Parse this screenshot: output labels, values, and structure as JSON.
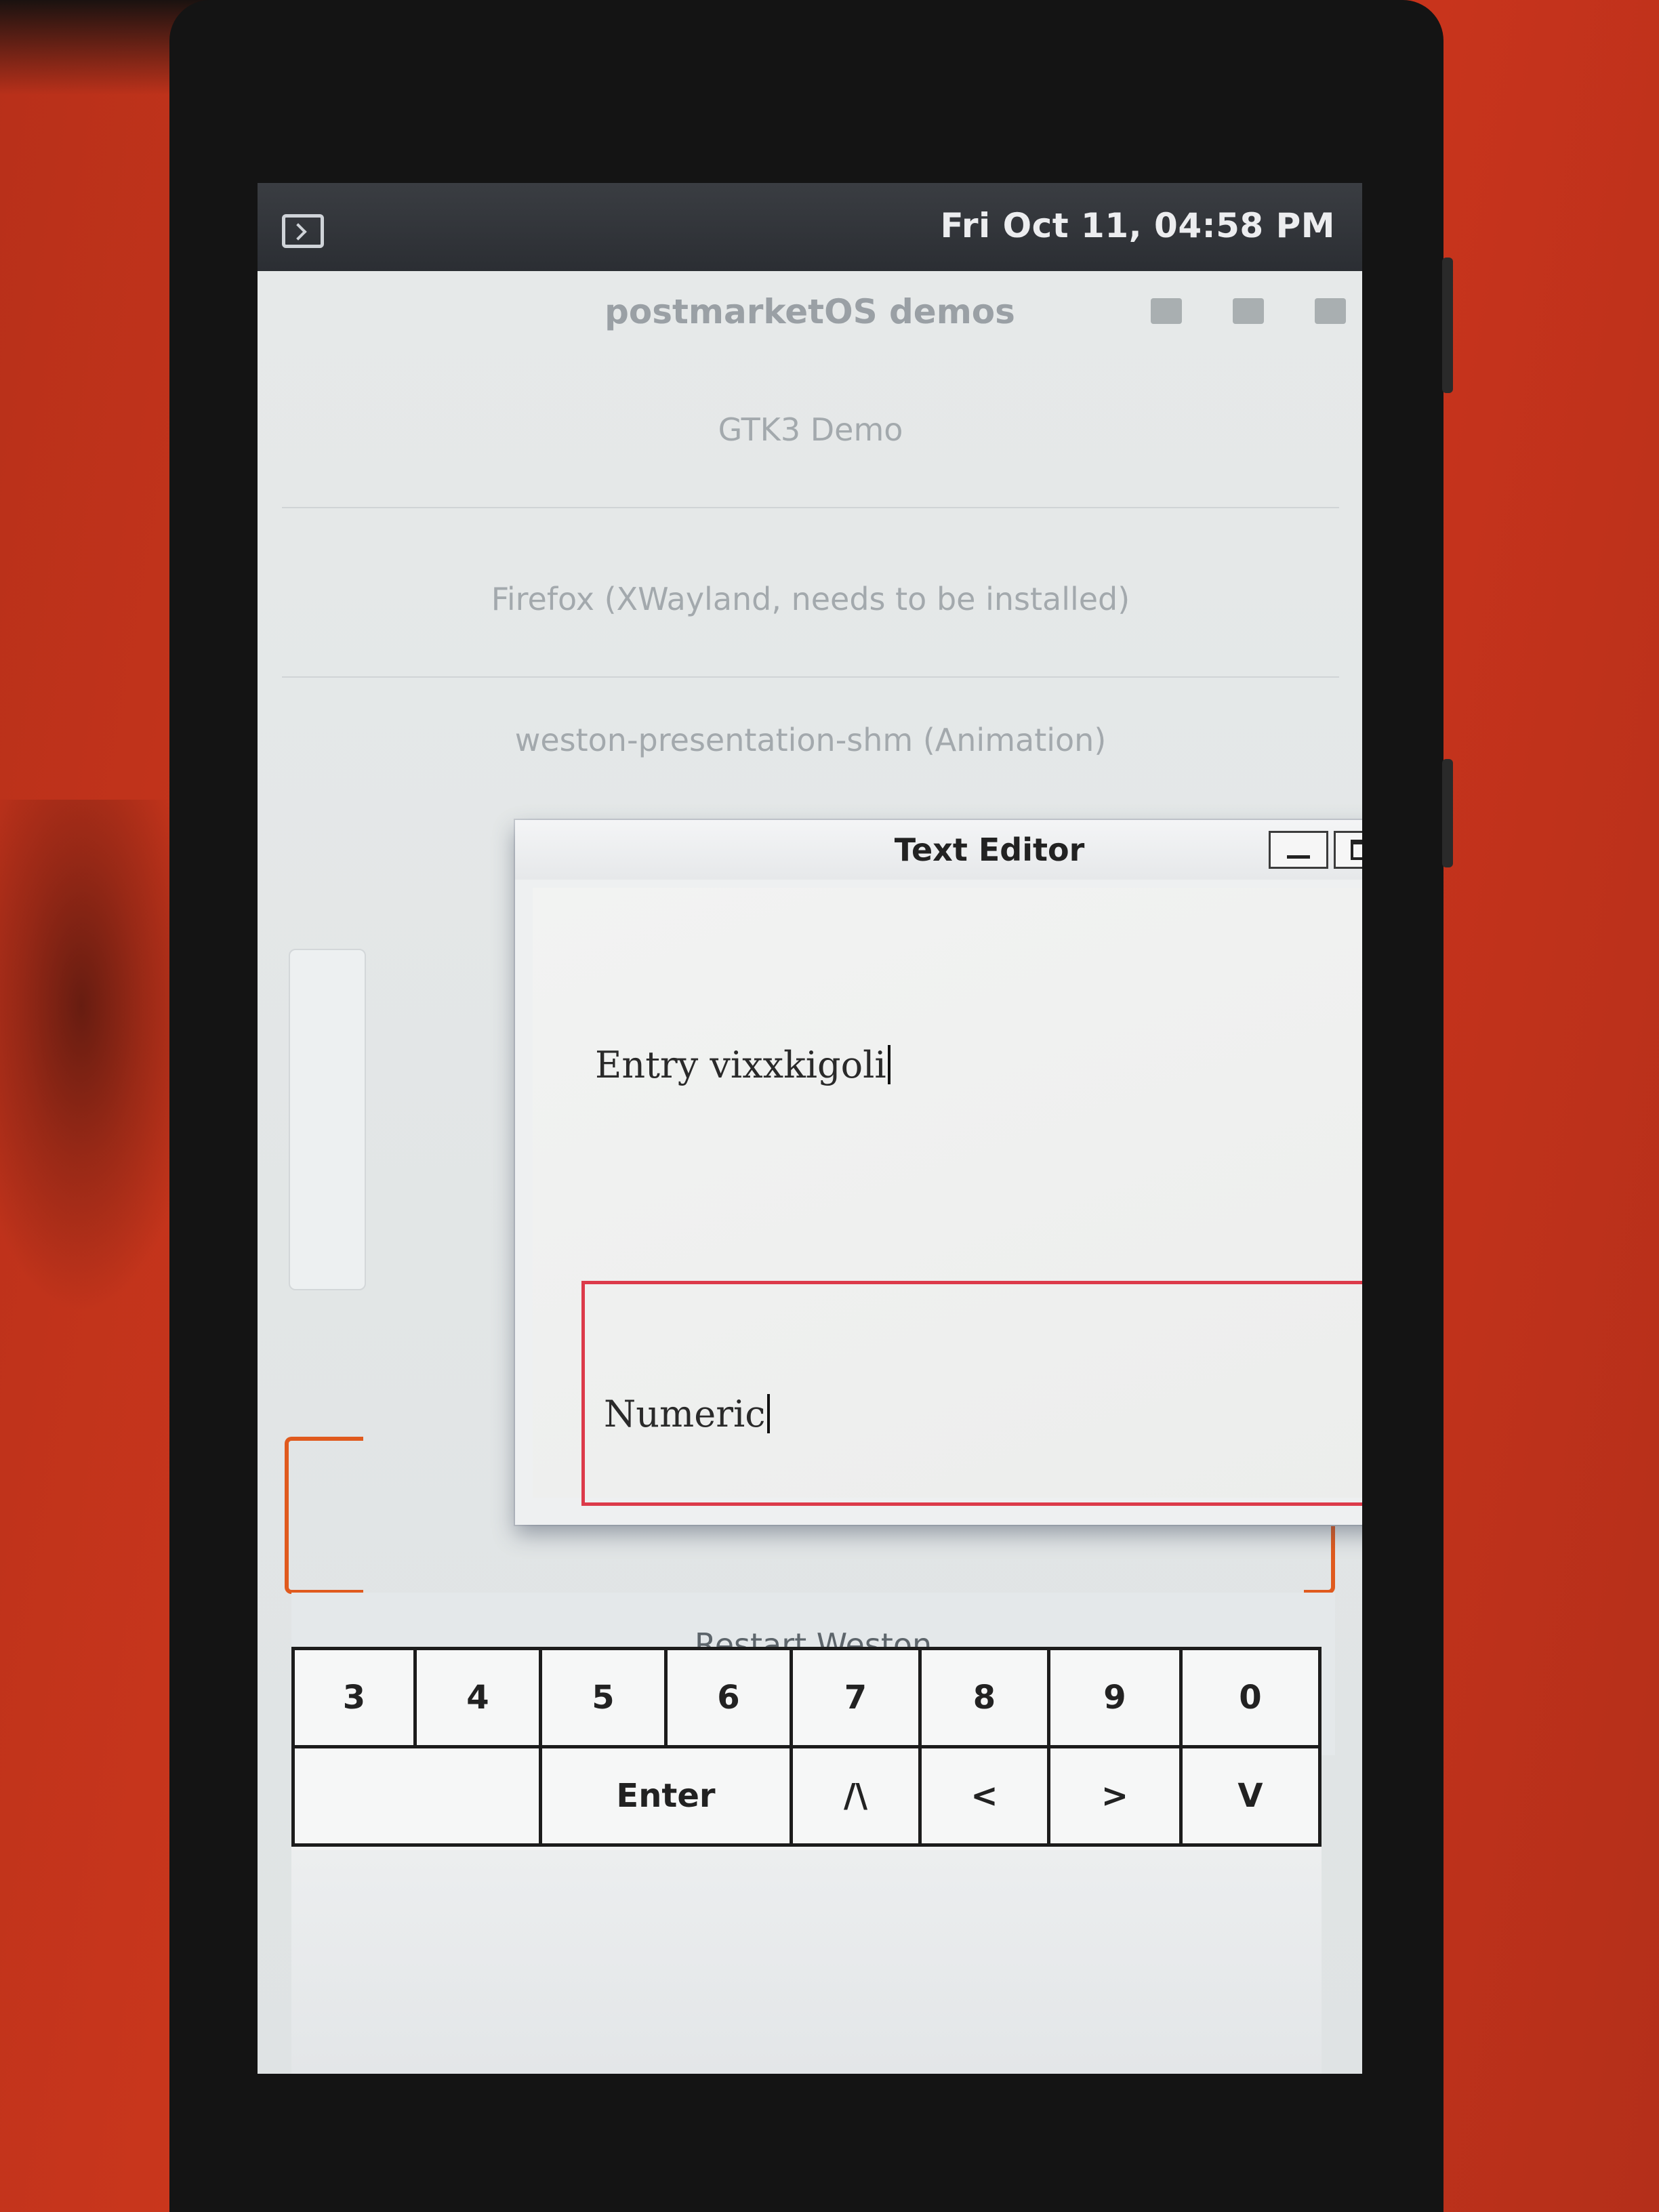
{
  "status_bar": {
    "datetime": "Fri Oct 11, 04:58 PM",
    "terminal_icon": "terminal-icon"
  },
  "launcher": {
    "title": "postmarketOS demos",
    "items": [
      {
        "label": "GTK3 Demo"
      },
      {
        "label": "Firefox (XWayland, needs to be installed)"
      },
      {
        "label": "weston-presentation-shm (Animation)"
      }
    ],
    "restart_label": "Restart Weston"
  },
  "editor": {
    "title": "Text Editor",
    "entry_value": "Entry vixxkigoli",
    "numeric_value": "Numeric",
    "buttons": {
      "minimize": "minimize-icon",
      "maximize": "maximize-icon",
      "close": "×"
    }
  },
  "keyboard": {
    "row1": [
      "3",
      "4",
      "5",
      "6",
      "7",
      "8",
      "9",
      "0"
    ],
    "row2": {
      "blank": "",
      "enter": "Enter",
      "up": "/\\",
      "left": "<",
      "right": ">",
      "down": "V"
    }
  },
  "colors": {
    "focus_border": "#dc3a4a",
    "status_bar_bg": "#2b2e33",
    "background_surface": "#d1391d"
  }
}
